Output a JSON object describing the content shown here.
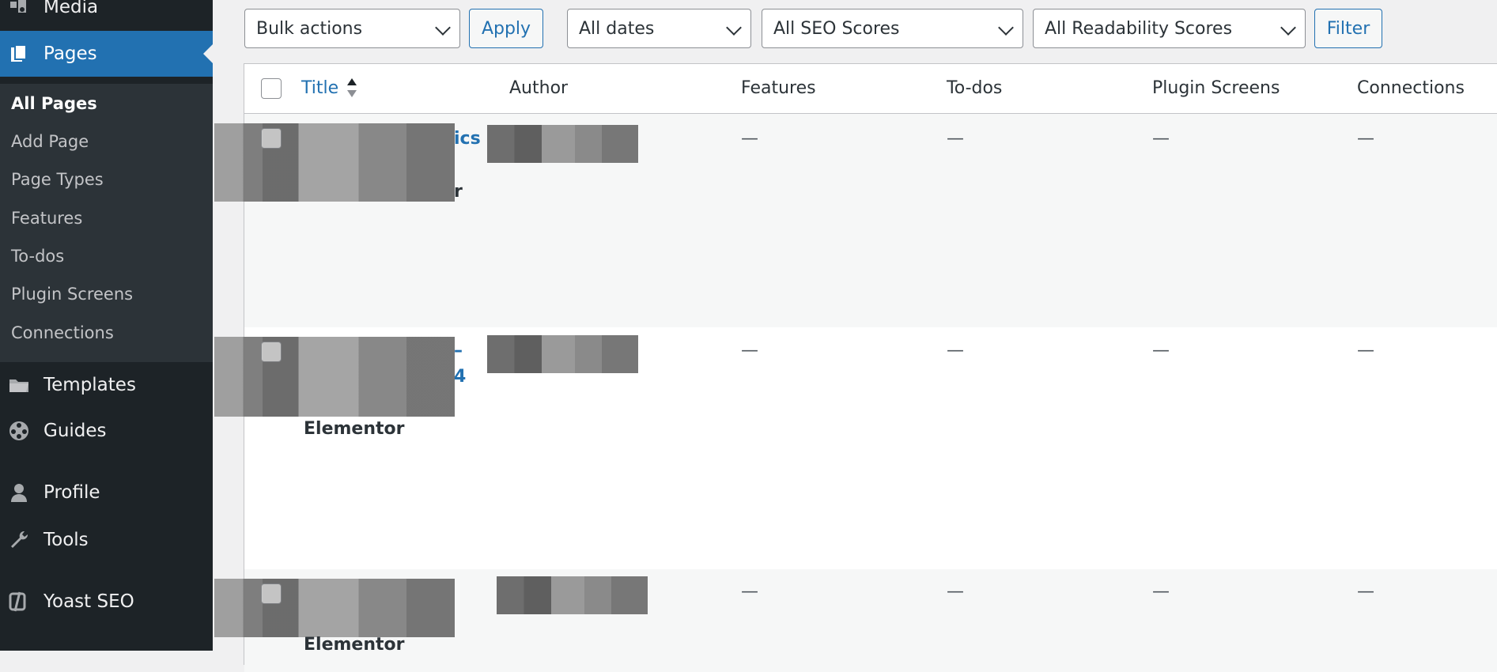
{
  "sidebar": {
    "top_items": [
      {
        "label": "Media",
        "icon": "media-icon"
      },
      {
        "label": "Pages",
        "icon": "pages-icon",
        "current": true
      }
    ],
    "submenu": [
      {
        "label": "All Pages",
        "active": true
      },
      {
        "label": "Add Page"
      },
      {
        "label": "Page Types"
      },
      {
        "label": "Features"
      },
      {
        "label": "To-dos"
      },
      {
        "label": "Plugin Screens"
      },
      {
        "label": "Connections"
      }
    ],
    "bottom_items": [
      {
        "label": "Templates",
        "icon": "folder-icon"
      },
      {
        "label": "Guides",
        "icon": "guides-icon"
      },
      {
        "label": "Profile",
        "icon": "user-icon"
      },
      {
        "label": "Tools",
        "icon": "wrench-icon"
      },
      {
        "label": "Yoast SEO",
        "icon": "yoast-icon"
      }
    ]
  },
  "filters": {
    "bulk_actions": "Bulk actions",
    "apply": "Apply",
    "dates": "All dates",
    "seo_scores": "All SEO Scores",
    "readability_scores": "All Readability Scores",
    "filter": "Filter"
  },
  "table": {
    "columns": [
      "Title",
      "Author",
      "Features",
      "To-dos",
      "Plugin Screens",
      "Connections"
    ],
    "empty_marker": "—",
    "rows": [
      {
        "title_fragments": [
          "ics",
          "r"
        ],
        "page_builder": ""
      },
      {
        "title_fragments": [
          "–",
          "4"
        ],
        "page_builder": "Elementor"
      },
      {
        "title_fragments": [],
        "page_builder": "Elementor"
      }
    ]
  },
  "colors": {
    "sidebar_bg": "#1d2327",
    "accent": "#2271b1",
    "page_bg": "#f0f0f1"
  }
}
